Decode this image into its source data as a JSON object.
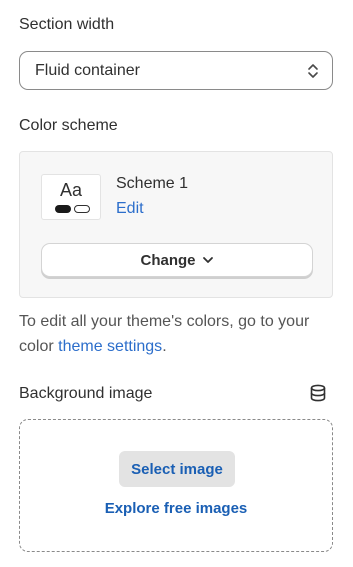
{
  "section_width": {
    "label": "Section width",
    "selected_value": "Fluid container"
  },
  "color_scheme": {
    "label": "Color scheme",
    "swatch_text": "Aa",
    "scheme_name": "Scheme 1",
    "edit_label": "Edit",
    "change_label": "Change",
    "help_prefix": "To edit all your theme's colors, go to your color ",
    "help_link": "theme settings",
    "help_suffix": "."
  },
  "background_image": {
    "label": "Background image",
    "select_button": "Select image",
    "explore_link": "Explore free images"
  },
  "colors": {
    "link": "#2c6ecb",
    "text": "#303030",
    "card_bg": "#f7f7f7"
  }
}
